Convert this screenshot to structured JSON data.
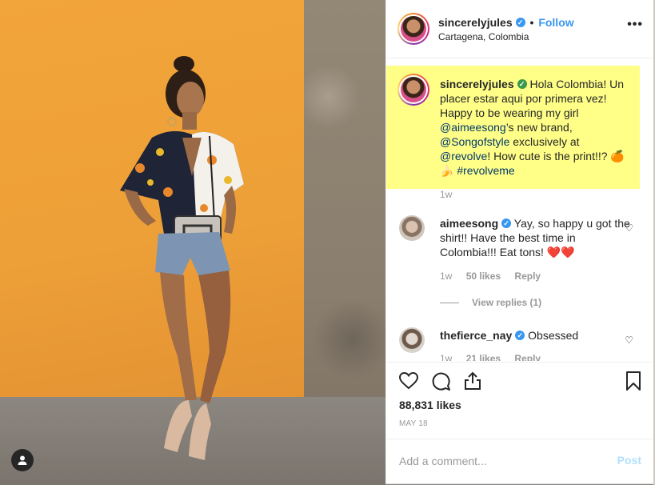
{
  "post": {
    "username": "sincerelyjules",
    "follow_label": "Follow",
    "separator": "•",
    "location": "Cartagena, Colombia",
    "more_label": "•••"
  },
  "caption": {
    "username": "sincerelyjules",
    "text_1": "Hola Colombia! Un placer estar aqui por primera vez! Happy to be wearing my girl ",
    "mention_1": "@aimeesong",
    "text_2": "’s new brand, ",
    "mention_2": "@Songofstyle",
    "text_3": " exclusively at ",
    "mention_3": "@revolve",
    "text_4": "! How cute is the print!!? 🍊🍌 ",
    "hashtag": "#revolveme",
    "time": "1w"
  },
  "comments": [
    {
      "username": "aimeesong",
      "text": "Yay, so happy u got the shirt!! Have the best time in Colombia!!! Eat tons! ❤️❤️",
      "time": "1w",
      "likes": "50 likes",
      "reply_label": "Reply"
    },
    {
      "username": "thefierce_nay",
      "text": "Obsessed",
      "time": "1w",
      "likes": "21 likes",
      "reply_label": "Reply"
    }
  ],
  "view_replies_label": "View replies (1)",
  "likes_count": "88,831 likes",
  "date": "MAY 18",
  "add_comment": {
    "placeholder": "Add a comment...",
    "post_label": "Post"
  },
  "colors": {
    "accent": "#3897f0",
    "caption_highlight": "#ffff88",
    "post_disabled": "#b2dffc"
  }
}
